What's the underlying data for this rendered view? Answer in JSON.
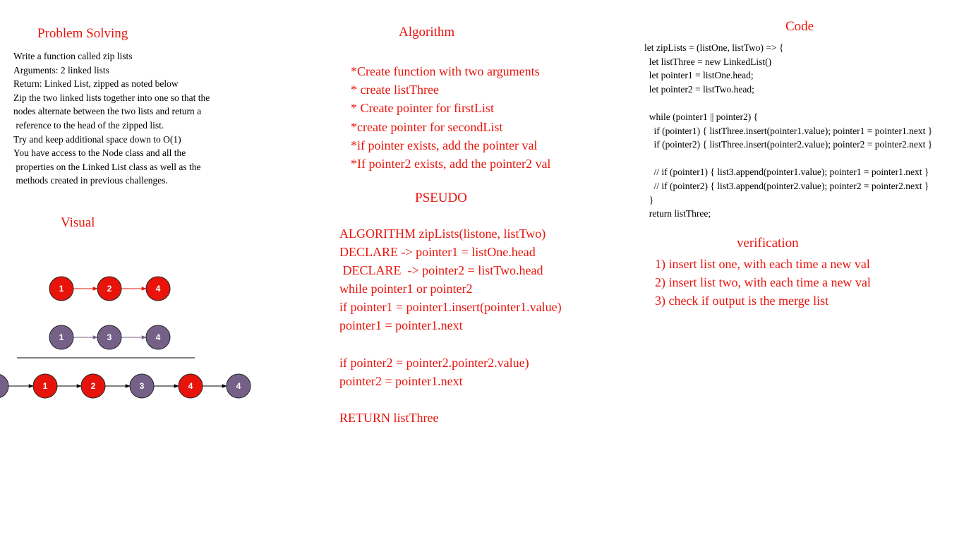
{
  "problem": {
    "title": "Problem Solving",
    "lines": [
      "Write a function called zip lists",
      "Arguments: 2 linked lists",
      "Return: Linked List, zipped as noted below",
      "Zip the two linked lists together into one so that the",
      "nodes alternate between the two lists and return a",
      " reference to the head of the zipped list.",
      "Try and keep additional space down to O(1)",
      "You have access to the Node class and all the",
      " properties on the Linked List class as well as the",
      " methods created in previous challenges."
    ]
  },
  "visual": {
    "title": "Visual",
    "list_one": [
      "1",
      "2",
      "4"
    ],
    "list_two": [
      "1",
      "3",
      "4"
    ],
    "result": [
      "",
      "1",
      "2",
      "3",
      "4",
      "4"
    ],
    "colors": {
      "red": "#e8140c",
      "purple": "#756188"
    }
  },
  "algorithm": {
    "title": "Algorithm",
    "lines": [
      "*Create function with two arguments",
      "* create listThree",
      "* Create pointer for firstList",
      "*create pointer for secondList",
      "*if pointer exists, add the pointer val",
      "*If pointer2 exists, add the pointer2 val"
    ]
  },
  "pseudo": {
    "title": "PSEUDO",
    "lines": [
      "ALGORITHM zipLists(listone, listTwo)",
      "DECLARE -> pointer1 = listOne.head",
      " DECLARE  -> pointer2 = listTwo.head",
      "while pointer1 or pointer2",
      "if pointer1 = pointer1.insert(pointer1.value)",
      "pointer1 = pointer1.next",
      "",
      "if pointer2 = pointer2.pointer2.value)",
      "pointer2 = pointer1.next",
      "",
      "RETURN listThree"
    ]
  },
  "code": {
    "title": "Code",
    "lines": [
      "let zipLists = (listOne, listTwo) => {",
      "  let listThree = new LinkedList()",
      "  let pointer1 = listOne.head;",
      "  let pointer2 = listTwo.head;",
      "",
      "  while (pointer1 || pointer2) {",
      "    if (pointer1) { listThree.insert(pointer1.value); pointer1 = pointer1.next }",
      "    if (pointer2) { listThree.insert(pointer2.value); pointer2 = pointer2.next }",
      "",
      "    // if (pointer1) { list3.append(pointer1.value); pointer1 = pointer1.next }",
      "    // if (pointer2) { list3.append(pointer2.value); pointer2 = pointer2.next }",
      "  }",
      "  return listThree;"
    ]
  },
  "verification": {
    "title": "verification",
    "lines": [
      "1) insert list one, with each time a new val",
      "2) insert list two, with each time a new val",
      "3) check if output is the merge list"
    ]
  }
}
